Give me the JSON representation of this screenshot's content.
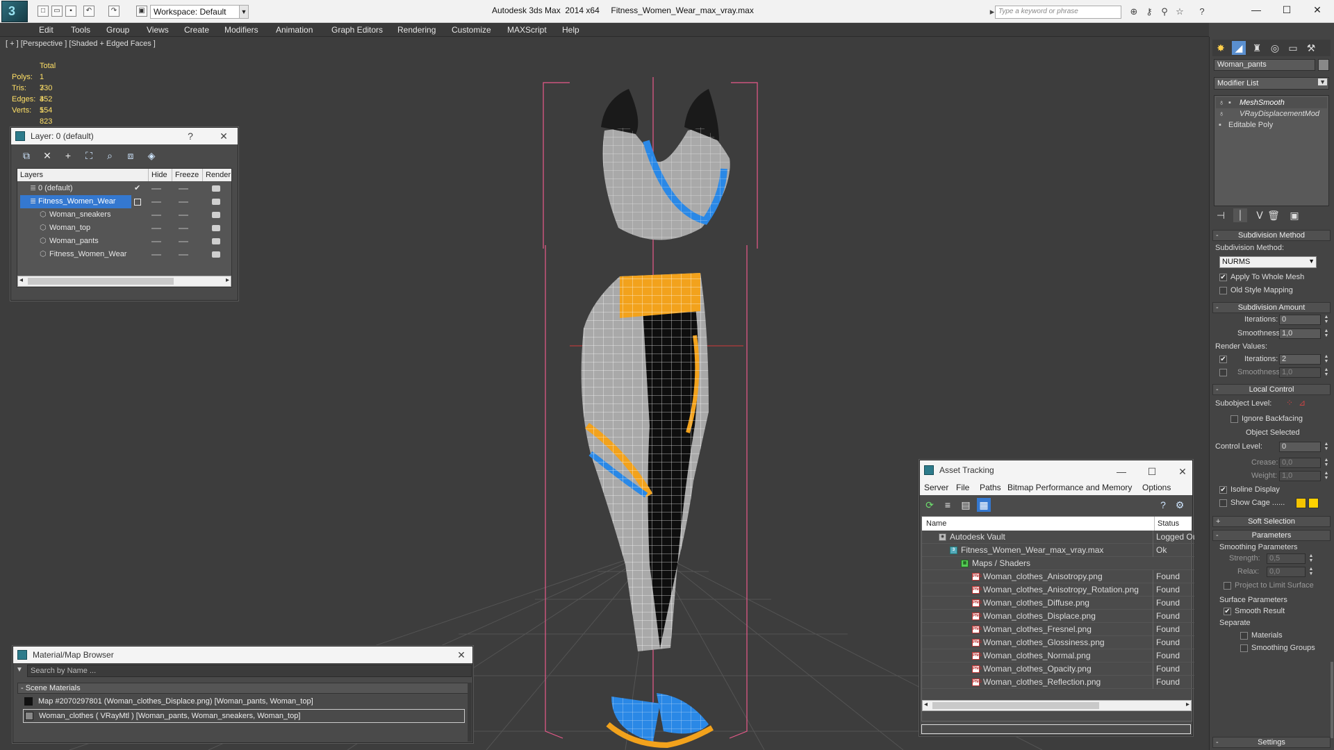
{
  "app": {
    "workspace": "Workspace: Default",
    "title": "Autodesk 3ds Max  2014 x64     Fitness_Women_Wear_max_vray.max",
    "search_placeholder": "Type a keyword or phrase"
  },
  "menu": [
    "Edit",
    "Tools",
    "Group",
    "Views",
    "Create",
    "Modifiers",
    "Animation",
    "Graph Editors",
    "Rendering",
    "Customize",
    "MAXScript",
    "Help"
  ],
  "viewport": {
    "label": "[ + ] [Perspective ] [Shaded + Edged Faces ]",
    "stats": {
      "header": "Total",
      "rows": [
        {
          "k": "Polys:",
          "v": "1 730"
        },
        {
          "k": "Tris:",
          "v": "3 452"
        },
        {
          "k": "Edges:",
          "v": "3 554"
        },
        {
          "k": "Verts:",
          "v": "1 823"
        }
      ]
    },
    "colors": {
      "wire": "#ffffff",
      "orange": "#f2a21c",
      "blue": "#2a88e6",
      "grey": "#a9a9a9",
      "black": "#0e0e0e",
      "bbox": "#e85a8a"
    }
  },
  "layer_panel": {
    "title": "Layer: 0 (default)",
    "help": "?",
    "cols": [
      "Layers",
      "Hide",
      "Freeze",
      "Render"
    ],
    "rows": [
      {
        "name": "0 (default)",
        "indent": 0,
        "check": "✔"
      },
      {
        "name": "Fitness_Women_Wear",
        "indent": 0,
        "selected": true
      },
      {
        "name": "Woman_sneakers",
        "indent": 1
      },
      {
        "name": "Woman_top",
        "indent": 1
      },
      {
        "name": "Woman_pants",
        "indent": 1
      },
      {
        "name": "Fitness_Women_Wear",
        "indent": 1
      }
    ]
  },
  "material_browser": {
    "title": "Material/Map Browser",
    "search_placeholder": "Search by Name ...",
    "section": "- Scene Materials",
    "items": [
      "Map #2070297801 (Woman_clothes_Displace.png)  [Woman_pants, Woman_top]",
      "Woman_clothes  ( VRayMtl )  [Woman_pants, Woman_sneakers, Woman_top]"
    ]
  },
  "asset_tracking": {
    "title": "Asset Tracking",
    "menu": [
      "Server",
      "File",
      "Paths",
      "Bitmap Performance and Memory",
      "Options"
    ],
    "cols": [
      "Name",
      "Status"
    ],
    "rows": [
      {
        "name": "Autodesk Vault",
        "status": "Logged Out",
        "indent": 20,
        "icon": "vault"
      },
      {
        "name": "Fitness_Women_Wear_max_vray.max",
        "status": "Ok",
        "indent": 36,
        "icon": "max"
      },
      {
        "name": "Maps / Shaders",
        "status": "",
        "indent": 52,
        "icon": "maps"
      },
      {
        "name": "Woman_clothes_Anisotropy.png",
        "status": "Found",
        "indent": 68,
        "icon": "png"
      },
      {
        "name": "Woman_clothes_Anisotropy_Rotation.png",
        "status": "Found",
        "indent": 68,
        "icon": "png"
      },
      {
        "name": "Woman_clothes_Diffuse.png",
        "status": "Found",
        "indent": 68,
        "icon": "png"
      },
      {
        "name": "Woman_clothes_Displace.png",
        "status": "Found",
        "indent": 68,
        "icon": "png"
      },
      {
        "name": "Woman_clothes_Fresnel.png",
        "status": "Found",
        "indent": 68,
        "icon": "png"
      },
      {
        "name": "Woman_clothes_Glossiness.png",
        "status": "Found",
        "indent": 68,
        "icon": "png"
      },
      {
        "name": "Woman_clothes_Normal.png",
        "status": "Found",
        "indent": 68,
        "icon": "png"
      },
      {
        "name": "Woman_clothes_Opacity.png",
        "status": "Found",
        "indent": 68,
        "icon": "png"
      },
      {
        "name": "Woman_clothes_Reflection.png",
        "status": "Found",
        "indent": 68,
        "icon": "png"
      }
    ]
  },
  "command_panel": {
    "object_name": "Woman_pants",
    "modifier_list": "Modifier List",
    "stack": [
      "MeshSmooth",
      "VRayDisplacementMod",
      "Editable Poly"
    ],
    "subdivision_method": {
      "header": "Subdivision Method",
      "label": "Subdivision Method:",
      "value": "NURMS",
      "apply_whole_mesh": "Apply To Whole Mesh",
      "old_style": "Old Style Mapping"
    },
    "subdivision_amount": {
      "header": "Subdivision Amount",
      "iterations_label": "Iterations:",
      "iterations": "0",
      "smoothness_label": "Smoothness:",
      "smoothness": "1,0",
      "render_values": "Render Values:",
      "r_iterations": "2",
      "r_smoothness": "1,0"
    },
    "local_control": {
      "header": "Local Control",
      "subobject": "Subobject Level:",
      "ignore_backfacing": "Ignore Backfacing",
      "object_selected": "Object Selected",
      "control_level_label": "Control Level:",
      "control_level": "0",
      "crease_label": "Crease:",
      "crease": "0,0",
      "weight_label": "Weight:",
      "weight": "1,0",
      "isoline": "Isoline Display",
      "show_cage": "Show Cage ......"
    },
    "soft_selection": "Soft Selection",
    "parameters": {
      "header": "Parameters",
      "smoothing": "Smoothing Parameters",
      "strength_label": "Strength:",
      "strength": "0,5",
      "relax_label": "Relax:",
      "relax": "0,0",
      "project": "Project to Limit Surface",
      "surface": "Surface Parameters",
      "smooth_result": "Smooth Result",
      "separate": "Separate",
      "materials": "Materials",
      "smoothing_groups": "Smoothing Groups"
    },
    "settings": "Settings",
    "cage_colors": [
      "#f5c400",
      "#ffd200"
    ]
  }
}
